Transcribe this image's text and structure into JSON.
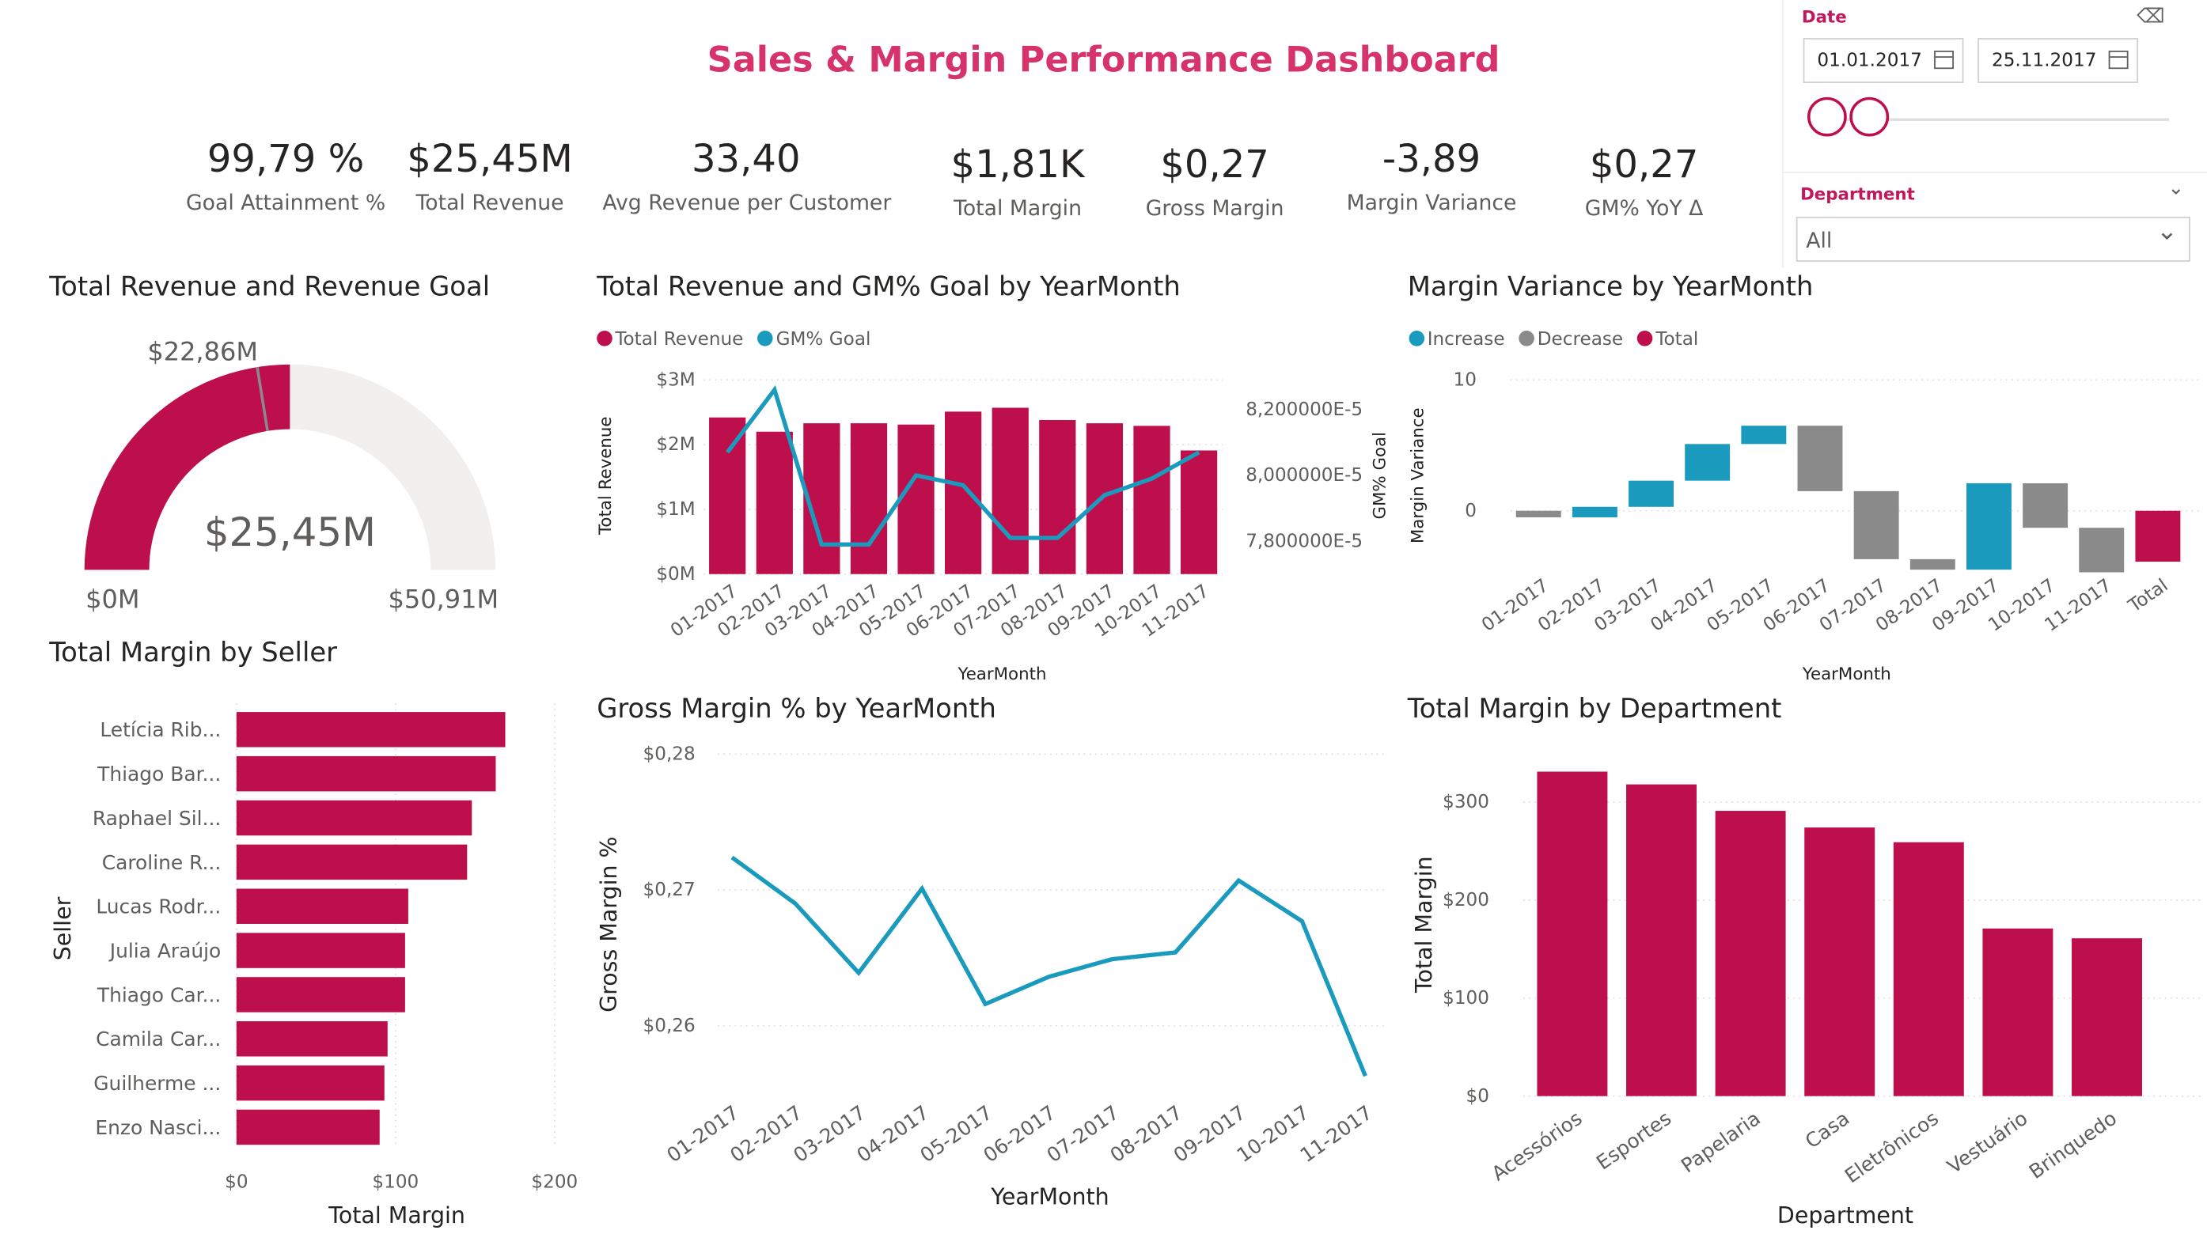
{
  "title": "Sales & Margin Performance Dashboard",
  "kpis": [
    {
      "value": "99,79 %",
      "label": "Goal Attainment %"
    },
    {
      "value": "$25,45M",
      "label": "Total Revenue"
    },
    {
      "value": "33,40",
      "label": "Avg Revenue per Customer"
    },
    {
      "value": "$1,81K",
      "label": "Total Margin"
    },
    {
      "value": "$0,27",
      "label": "Gross Margin"
    },
    {
      "value": "-3,89",
      "label": "Margin Variance"
    },
    {
      "value": "$0,27",
      "label": "GM% YoY Δ"
    }
  ],
  "slicers": {
    "date": {
      "label": "Date",
      "start": "01.01.2017",
      "end": "25.11.2017",
      "start_fraction": 0.0,
      "end_fraction": 0.0
    },
    "department": {
      "label": "Department",
      "value": "All"
    }
  },
  "colors": {
    "primary": "#be0f4d",
    "teal": "#1a9bbd",
    "gray": "#8a8a8a",
    "title": "#d6336c",
    "gauge_bg": "#f1f0ef"
  },
  "visuals": {
    "gauge": {
      "title": "Total Revenue and Revenue Goal",
      "value_label": "$25,45M",
      "goal_label": "$22,86M",
      "min_label": "$0M",
      "max_label": "$50,91M"
    },
    "combo": {
      "title": "Total Revenue and GM% Goal by YearMonth",
      "legend": [
        "Total Revenue",
        "GM% Goal"
      ],
      "xlabel": "YearMonth",
      "ylabel": "Total Revenue",
      "y2label": "GM% Goal"
    },
    "waterfall": {
      "title": "Margin Variance by YearMonth",
      "legend": [
        "Increase",
        "Decrease",
        "Total"
      ],
      "xlabel": "YearMonth",
      "ylabel": "Margin Variance"
    },
    "seller": {
      "title": "Total Margin by Seller",
      "xlabel": "Total Margin",
      "ylabel": "Seller"
    },
    "gm_line": {
      "title": "Gross Margin % by YearMonth",
      "xlabel": "YearMonth",
      "ylabel": "Gross Margin %"
    },
    "dept": {
      "title": "Total Margin by Department",
      "xlabel": "Department",
      "ylabel": "Total Margin"
    }
  },
  "chart_data": [
    {
      "id": "gauge",
      "type": "gauge",
      "value": 25.45,
      "goal": 22.86,
      "min": 0,
      "max": 50.91,
      "unit": "$M"
    },
    {
      "id": "combo",
      "type": "bar",
      "categories": [
        "01-2017",
        "02-2017",
        "03-2017",
        "04-2017",
        "05-2017",
        "06-2017",
        "07-2017",
        "08-2017",
        "09-2017",
        "10-2017",
        "11-2017"
      ],
      "series": [
        {
          "name": "Total Revenue",
          "type": "bar",
          "axis": "left",
          "values": [
            2.42,
            2.2,
            2.33,
            2.33,
            2.31,
            2.51,
            2.57,
            2.38,
            2.33,
            2.29,
            1.91
          ]
        },
        {
          "name": "GM% Goal",
          "type": "line",
          "axis": "right",
          "values": [
            8.07e-05,
            8.26e-05,
            7.79e-05,
            7.79e-05,
            8e-05,
            7.97e-05,
            7.81e-05,
            7.81e-05,
            7.94e-05,
            7.99e-05,
            8.07e-05
          ]
        }
      ],
      "ylim": [
        0,
        3
      ],
      "yticks": [
        "$0M",
        "$1M",
        "$2M",
        "$3M"
      ],
      "y2ticks": [
        "7,800000E-5",
        "8,000000E-5",
        "8,200000E-5"
      ],
      "y2ticks_values": [
        7.8e-05,
        8e-05,
        8.2e-05
      ]
    },
    {
      "id": "waterfall",
      "type": "bar",
      "subtype": "waterfall",
      "categories": [
        "01-2017",
        "02-2017",
        "03-2017",
        "04-2017",
        "05-2017",
        "06-2017",
        "07-2017",
        "08-2017",
        "09-2017",
        "10-2017",
        "11-2017",
        "Total"
      ],
      "deltas": [
        -0.5,
        0.8,
        2.0,
        2.8,
        1.4,
        -5.0,
        -5.2,
        -0.8,
        6.6,
        -3.4,
        -3.4,
        -3.89
      ],
      "ylim": [
        -10,
        10
      ],
      "yticks": [
        "0",
        "10"
      ],
      "yticks_values": [
        0,
        10
      ]
    },
    {
      "id": "seller",
      "type": "bar",
      "orientation": "horizontal",
      "categories": [
        "Letícia Rib...",
        "Thiago Bar...",
        "Raphael Sil...",
        "Caroline R...",
        "Lucas Rodr...",
        "Julia Araújo",
        "Thiago Car...",
        "Camila Car...",
        "Guilherme ...",
        "Enzo Nasci..."
      ],
      "values": [
        169,
        163,
        148,
        145,
        108,
        106,
        106,
        95,
        93,
        90
      ],
      "xlim": [
        0,
        200
      ],
      "xticks": [
        "$0",
        "$100",
        "$200"
      ]
    },
    {
      "id": "gm_line",
      "type": "line",
      "categories": [
        "01-2017",
        "02-2017",
        "03-2017",
        "04-2017",
        "05-2017",
        "06-2017",
        "07-2017",
        "08-2017",
        "09-2017",
        "10-2017",
        "11-2017"
      ],
      "values": [
        0.2724,
        0.269,
        0.2639,
        0.2701,
        0.2616,
        0.2636,
        0.2649,
        0.2654,
        0.2707,
        0.2677,
        0.2563
      ],
      "ylim": [
        0.255,
        0.28
      ],
      "yticks": [
        "$0,26",
        "$0,27",
        "$0,28"
      ],
      "yticks_values": [
        0.26,
        0.27,
        0.28
      ]
    },
    {
      "id": "dept",
      "type": "bar",
      "categories": [
        "Acessórios",
        "Esportes",
        "Papelaria",
        "Casa",
        "Eletrônicos",
        "Vestuário",
        "Brinquedo"
      ],
      "values": [
        331,
        318,
        291,
        274,
        259,
        171,
        161
      ],
      "ylim": [
        0,
        350
      ],
      "yticks": [
        "$0",
        "$100",
        "$200",
        "$300"
      ],
      "yticks_values": [
        0,
        100,
        200,
        300
      ]
    }
  ]
}
